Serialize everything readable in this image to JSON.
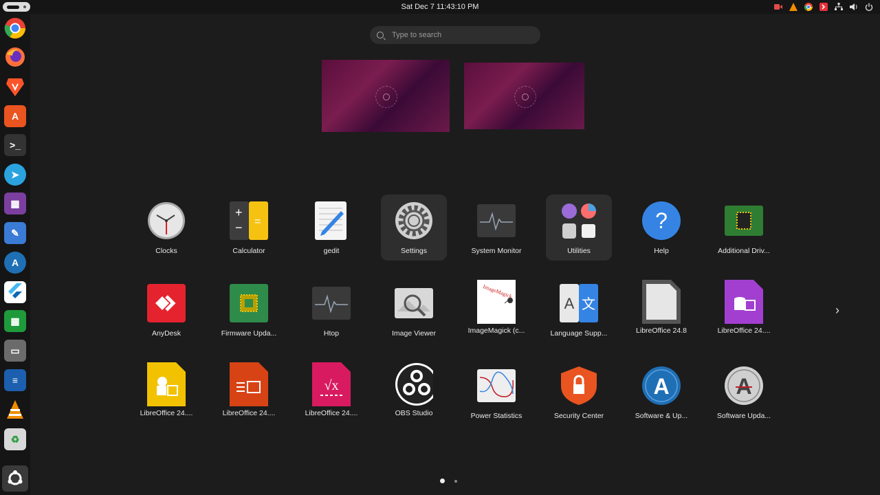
{
  "topbar": {
    "clock": "Sat Dec 7  11:43:10 PM",
    "tray_icons": [
      "screencast-icon",
      "vlc-icon",
      "chrome-icon",
      "anydesk-icon",
      "network-icon",
      "volume-icon",
      "power-icon"
    ]
  },
  "search": {
    "placeholder": "Type to search"
  },
  "dock": {
    "items": [
      {
        "name": "google-chrome",
        "glyph": "",
        "color": "#4285f4"
      },
      {
        "name": "firefox",
        "glyph": "",
        "color": "#ff7139"
      },
      {
        "name": "brave",
        "glyph": "",
        "color": "#fb542b"
      },
      {
        "name": "app-center",
        "glyph": "A",
        "color": "#e95420"
      },
      {
        "name": "terminal",
        "glyph": ">_",
        "color": "#333333"
      },
      {
        "name": "telegram",
        "glyph": "➤",
        "color": "#2aa3df"
      },
      {
        "name": "video-app",
        "glyph": "▦",
        "color": "#7b3fa0"
      },
      {
        "name": "text-editor",
        "glyph": "✎",
        "color": "#3a7bd5"
      },
      {
        "name": "software-updater",
        "glyph": "A",
        "color": "#1f6fb5"
      },
      {
        "name": "flutter",
        "glyph": "◣",
        "color": "#ffffff"
      },
      {
        "name": "libreoffice-calc",
        "glyph": "▦",
        "color": "#1e9a3b"
      },
      {
        "name": "files",
        "glyph": "▭",
        "color": "#6b6b6b"
      },
      {
        "name": "libreoffice-writer",
        "glyph": "≡",
        "color": "#1b5fae"
      },
      {
        "name": "vlc",
        "glyph": "▲",
        "color": "#f08c00"
      },
      {
        "name": "trash",
        "glyph": "♻",
        "color": "#d8d8d8"
      },
      {
        "name": "show-apps",
        "glyph": "⚙",
        "color": "#3a3a3a"
      }
    ]
  },
  "apps": [
    {
      "label": "Clocks",
      "icon": "clock-icon"
    },
    {
      "label": "Calculator",
      "icon": "calculator-icon"
    },
    {
      "label": "gedit",
      "icon": "gedit-icon"
    },
    {
      "label": "Settings",
      "icon": "settings-icon"
    },
    {
      "label": "System Monitor",
      "icon": "system-monitor-icon"
    },
    {
      "label": "Utilities",
      "icon": "utilities-folder-icon"
    },
    {
      "label": "Help",
      "icon": "help-icon"
    },
    {
      "label": "Additional Driv...",
      "icon": "chip-icon"
    },
    {
      "label": "AnyDesk",
      "icon": "anydesk-icon"
    },
    {
      "label": "Firmware Upda...",
      "icon": "firmware-chip-icon"
    },
    {
      "label": "Htop",
      "icon": "htop-icon"
    },
    {
      "label": "Image Viewer",
      "icon": "image-viewer-icon"
    },
    {
      "label": "ImageMagick (c...",
      "icon": "imagemagick-icon"
    },
    {
      "label": "Language Supp...",
      "icon": "language-icon"
    },
    {
      "label": "LibreOffice 24.8",
      "icon": "libreoffice-icon"
    },
    {
      "label": "LibreOffice 24....",
      "icon": "libreoffice-base-icon"
    },
    {
      "label": "LibreOffice 24....",
      "icon": "libreoffice-draw-icon"
    },
    {
      "label": "LibreOffice 24....",
      "icon": "libreoffice-impress-icon"
    },
    {
      "label": "LibreOffice 24....",
      "icon": "libreoffice-math-icon"
    },
    {
      "label": "OBS Studio",
      "icon": "obs-icon"
    },
    {
      "label": "Power Statistics",
      "icon": "power-statistics-icon"
    },
    {
      "label": "Security Center",
      "icon": "security-center-icon"
    },
    {
      "label": "Software & Up...",
      "icon": "software-sources-icon"
    },
    {
      "label": "Software Upda...",
      "icon": "software-updater-icon"
    }
  ],
  "pager": {
    "pages": 2,
    "current": 1
  },
  "next_arrow": "›"
}
